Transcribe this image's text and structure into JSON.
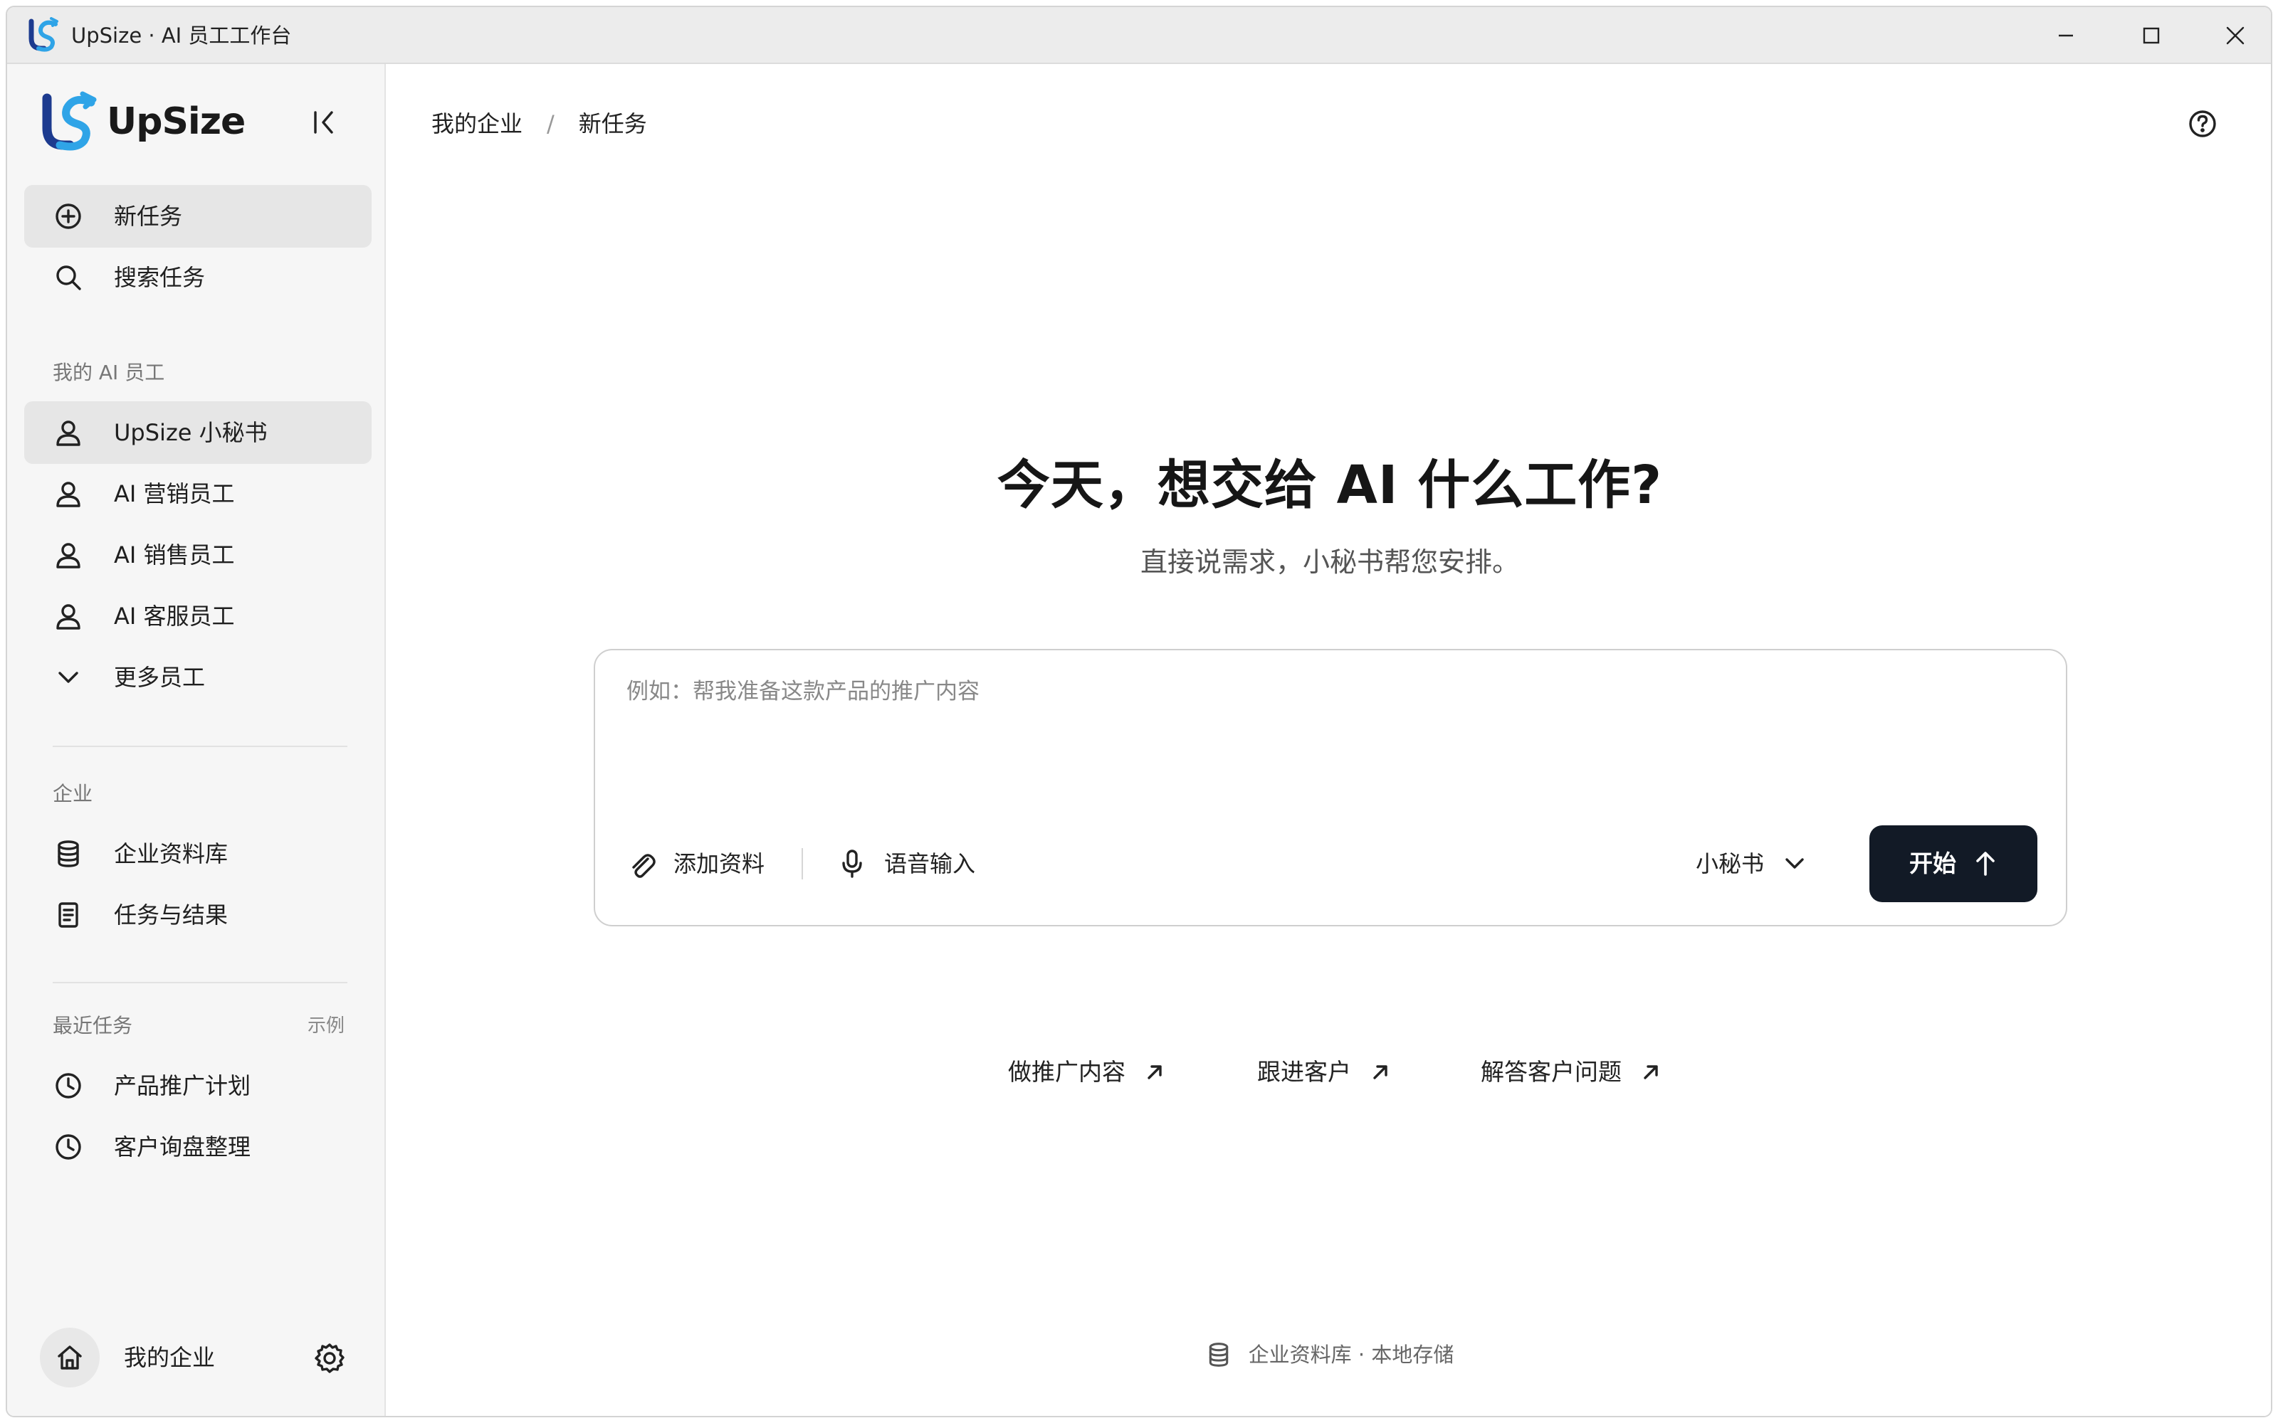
{
  "window": {
    "title": "UpSize · AI 员工工作台",
    "controls": [
      "minimize-icon",
      "maximize-icon",
      "close-icon"
    ]
  },
  "sidebar": {
    "brand": "UpSize",
    "primary": [
      {
        "label": "新任务",
        "icon": "plus-circle-icon",
        "active": true
      },
      {
        "label": "搜索任务",
        "icon": "search-icon",
        "active": false
      }
    ],
    "employees_label": "我的 AI 员工",
    "employees": [
      {
        "label": "UpSize 小秘书",
        "icon": "user-icon",
        "active": true
      },
      {
        "label": "AI 营销员工",
        "icon": "user-icon",
        "active": false
      },
      {
        "label": "AI 销售员工",
        "icon": "user-icon",
        "active": false
      },
      {
        "label": "AI 客服员工",
        "icon": "user-icon",
        "active": false
      },
      {
        "label": "更多员工",
        "icon": "chevron-down-icon",
        "active": false
      }
    ],
    "enterprise_label": "企业",
    "enterprise": [
      {
        "label": "企业资料库",
        "icon": "database-icon"
      },
      {
        "label": "任务与结果",
        "icon": "document-icon"
      }
    ],
    "recent_label": "最近任务",
    "recent_aside": "示例",
    "recent": [
      {
        "label": "产品推广计划",
        "icon": "clock-icon"
      },
      {
        "label": "客户询盘整理",
        "icon": "clock-icon"
      }
    ],
    "user": {
      "name": "我的企业",
      "avatar_icon": "home-icon",
      "settings_icon": "gear-icon"
    }
  },
  "main": {
    "breadcrumb": [
      "我的企业",
      "新任务"
    ],
    "breadcrumb_sep": "/",
    "headline": "今天，想交给 AI 什么工作?",
    "subheadline": "直接说需求，小秘书帮您安排。",
    "composer": {
      "placeholder": "例如：帮我准备这款产品的推广内容",
      "value": "",
      "attach_label": "添加资料",
      "voice_label": "语音输入",
      "agent_label": "小秘书",
      "start_label": "开始"
    },
    "suggestions": [
      "做推广内容",
      "跟进客户",
      "解答客户问题"
    ],
    "footer": "企业资料库 · 本地存储"
  },
  "colors": {
    "primary_button": "#121a26",
    "sidebar_bg": "#f6f6f6",
    "active_item_bg": "#e6e6e6",
    "logo_dark": "#1d3b8f",
    "logo_light": "#2fa4e7"
  }
}
